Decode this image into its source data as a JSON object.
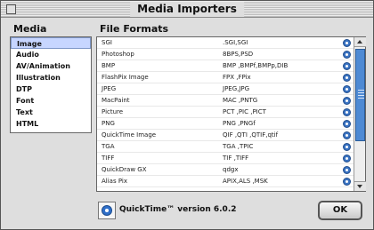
{
  "window": {
    "title": "Media Importers"
  },
  "media": {
    "heading": "Media",
    "items": [
      "Image",
      "Audio",
      "AV/Animation",
      "Illustration",
      "DTP",
      "Font",
      "Text",
      "HTML"
    ],
    "selected": "Image"
  },
  "formats": {
    "heading": "File Formats",
    "rows": [
      {
        "name": "SGI",
        "ext": ".SGI,SGI"
      },
      {
        "name": "Photoshop",
        "ext": "8BPS,PSD"
      },
      {
        "name": "BMP",
        "ext": "BMP ,BMPf,BMPp,DIB"
      },
      {
        "name": "FlashPix Image",
        "ext": "FPX ,FPix"
      },
      {
        "name": "JPEG",
        "ext": "JPEG,JPG"
      },
      {
        "name": "MacPaint",
        "ext": "MAC ,PNTG"
      },
      {
        "name": "Picture",
        "ext": "PCT ,PIC ,PICT"
      },
      {
        "name": "PNG",
        "ext": "PNG ,PNGf"
      },
      {
        "name": "QuickTime Image",
        "ext": "QIF ,QTI ,QTIF,qtif"
      },
      {
        "name": "TGA",
        "ext": "TGA ,TPIC"
      },
      {
        "name": "TIFF",
        "ext": "TIF ,TIFF"
      },
      {
        "name": "QuickDraw GX",
        "ext": "qdgx"
      },
      {
        "name": "Alias Pix",
        "ext": "APIX,ALS ,MSK"
      }
    ]
  },
  "footer": {
    "version_text": "QuickTime™ version 6.0.2",
    "ok_label": "OK"
  },
  "icons": {
    "row_icon": "quicktime-icon",
    "logo": "quicktime-logo-icon"
  }
}
